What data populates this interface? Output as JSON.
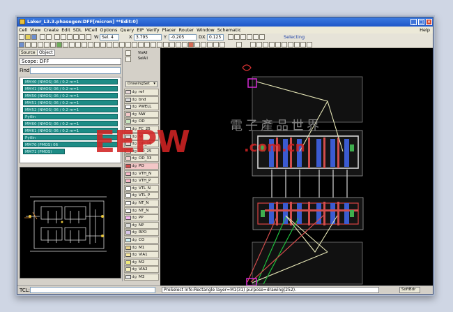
{
  "window": {
    "title": "Laker_L3.3.phasegen:DFF[micron] **Edit:0]"
  },
  "menu": [
    "Cell",
    "View",
    "Create",
    "Edit",
    "SDL",
    "MCell",
    "Options",
    "Query",
    "EIP",
    "Verify",
    "Placer",
    "Router",
    "Window",
    "Schematic"
  ],
  "menu_help": "Help",
  "toolbar": {
    "width_label": "W",
    "width_value": "Sel. 4",
    "x_label": "X",
    "x_value": "3.795",
    "y_label": "Y",
    "y_value": "-0.205",
    "dx_label": "DX",
    "dx_value": "0.125",
    "mode_text": "Selecting"
  },
  "left_panel": {
    "tabs": [
      "Source",
      "Object"
    ],
    "scope_label": "Scope:",
    "scope_value": "DFF",
    "find_label": "Find:",
    "objects": [
      "MM40 (NMOS) 06 / 0.2 m=1",
      "MM41 (NMOS) 06 / 0.2 m=1",
      "MM50 (NMOS) 06 / 0.2 m=1",
      "MM51 (NMOS) 06 / 0.2 m=1",
      "MM52 (NMOS) 06 / 0.2 m=1",
      "Pytlin",
      "MM60 (NMOS) 06 / 0.2 m=1",
      "MM61 (NMOS) 06 / 0.2 m=1",
      "Pytlin",
      "MM70 (PMOS) 06",
      "MM71 (PMOS)"
    ]
  },
  "layer_panel": {
    "vis_labels": [
      "VisAll",
      "SelAll"
    ],
    "drawing_set": "DrawingSet",
    "layers": [
      {
        "dg": "dg",
        "name": "ref",
        "color": "#e9d9d9"
      },
      {
        "dg": "dg",
        "name": "bnd",
        "color": "#d9d9d9"
      },
      {
        "dg": "dg",
        "name": "PWELL",
        "color": "#ffffff"
      },
      {
        "dg": "dg",
        "name": "NW",
        "color": "#f2c7c7"
      },
      {
        "dg": "dg",
        "name": "OD",
        "color": "#c9e5c0"
      },
      {
        "dg": "dg",
        "name": "FC_25",
        "color": "#ffffff"
      },
      {
        "dg": "dg",
        "name": "NI",
        "color": "#dddddd"
      },
      {
        "dg": "dg",
        "name": "OD_18",
        "color": "#f0d0d0"
      },
      {
        "dg": "dg",
        "name": "OD_25",
        "color": "#f0b0b0"
      },
      {
        "dg": "dg",
        "name": "OD_33",
        "color": "#f0d0d0"
      },
      {
        "dg": "dg",
        "name": "PO",
        "color": "#d24d4d"
      },
      {
        "dg": "dg",
        "name": "VTH_N",
        "color": "#f6b9c7"
      },
      {
        "dg": "dg",
        "name": "VTH_P",
        "color": "#f6b9c7"
      },
      {
        "dg": "dg",
        "name": "VTL_N",
        "color": "#ffffff"
      },
      {
        "dg": "dg",
        "name": "VTL_P",
        "color": "#ffffff"
      },
      {
        "dg": "dg",
        "name": "NT_N",
        "color": "#ffffff"
      },
      {
        "dg": "dg",
        "name": "NT_N",
        "color": "#ffffff"
      },
      {
        "dg": "dg",
        "name": "PP",
        "color": "#f4b6ef"
      },
      {
        "dg": "dg",
        "name": "NP",
        "color": "#dcdcdc"
      },
      {
        "dg": "dg",
        "name": "RPO",
        "color": "#d7c6e9"
      },
      {
        "dg": "dg",
        "name": "CO",
        "color": "#cdeef0"
      },
      {
        "dg": "dg",
        "name": "M1",
        "color": "#e9d38a"
      },
      {
        "dg": "dg",
        "name": "VIA1",
        "color": "#f5e6a0"
      },
      {
        "dg": "dg",
        "name": "M2",
        "color": "#f0e97a"
      },
      {
        "dg": "dg",
        "name": "VIA2",
        "color": "#f6f0ba"
      },
      {
        "dg": "dg",
        "name": "M3",
        "color": "#e6e6e6"
      }
    ]
  },
  "status": {
    "tcl_label": "TCL:",
    "message": "PreSelect Info:Rectangle layer=M1(31) purpose=drawing(252).",
    "soft_button": "SoftBdr"
  },
  "watermark": {
    "logo": "EEPW",
    "domain": ".com.cn",
    "cjk": "電子產品世界"
  },
  "colors": {
    "title_bar": "#1e56c8",
    "canvas_bg": "#000000",
    "object_item": "#1d8c86",
    "poly": "#d24d4d",
    "diffusion": "#3b5bd1",
    "metal1": "#e0e0a0",
    "route_green": "#1fbf3d",
    "highlight_magenta": "#d62bd6"
  }
}
